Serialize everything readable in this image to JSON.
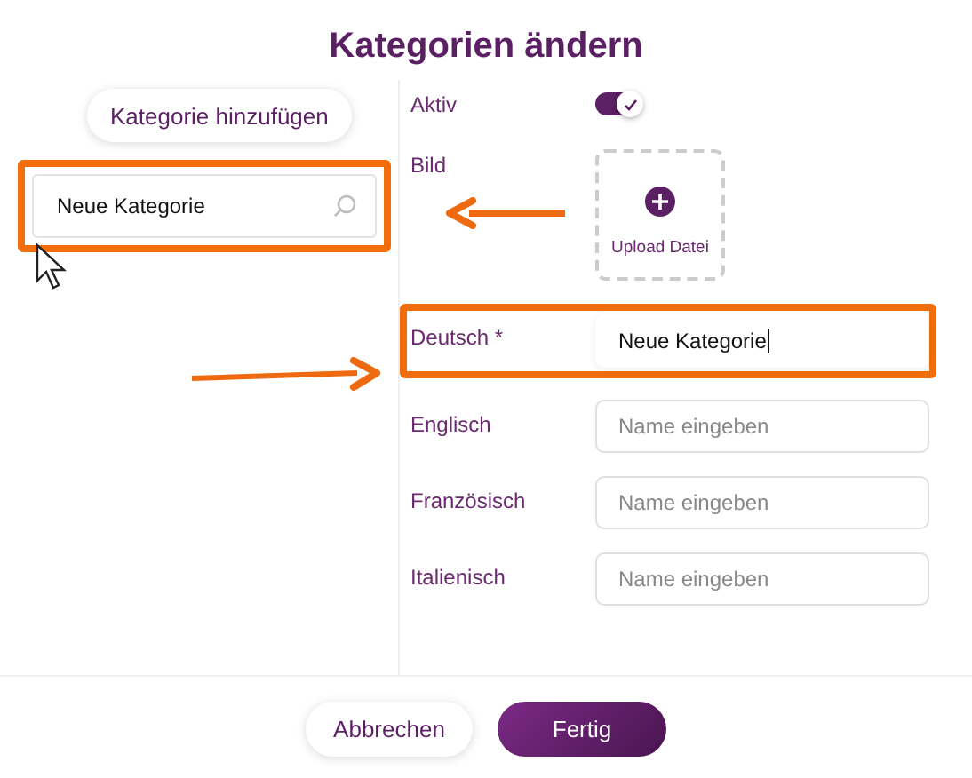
{
  "title": "Kategorien ändern",
  "add_button": "Kategorie hinzufügen",
  "search": {
    "value": "Neue Kategorie",
    "highlighted": true
  },
  "active": {
    "label": "Aktiv",
    "on": true
  },
  "image": {
    "label": "Bild",
    "upload_label": "Upload Datei"
  },
  "fields": [
    {
      "label": "Deutsch *",
      "value": "Neue Kategorie",
      "focused": true,
      "highlighted": true
    },
    {
      "label": "Englisch",
      "placeholder": "Name eingeben",
      "focused": false,
      "highlighted": false
    },
    {
      "label": "Französisch",
      "placeholder": "Name eingeben",
      "focused": false,
      "highlighted": false
    },
    {
      "label": "Italienisch",
      "placeholder": "Name eingeben",
      "focused": false,
      "highlighted": false
    }
  ],
  "buttons": [
    {
      "label": "Abbrechen",
      "kind": "secondary"
    },
    {
      "label": "Fertig",
      "kind": "primary"
    }
  ]
}
